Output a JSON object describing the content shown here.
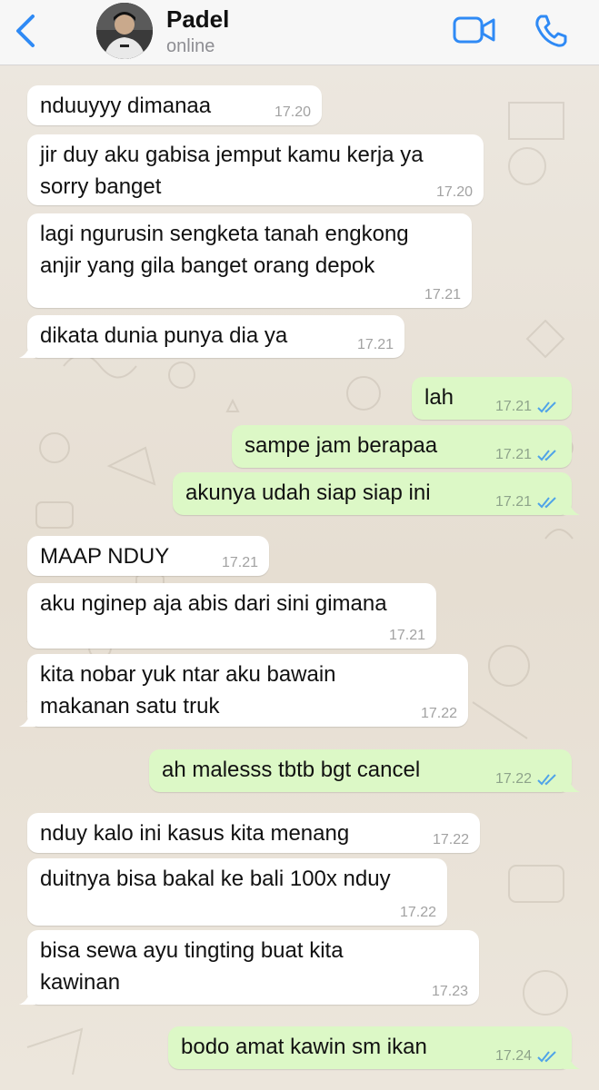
{
  "header": {
    "contact_name": "Padel",
    "status": "online",
    "icons": [
      "back-chevron-icon",
      "video-call-icon",
      "phone-call-icon"
    ]
  },
  "colors": {
    "incoming_bubble": "#ffffff",
    "outgoing_bubble": "#dcf8c6",
    "accent": "#2f8af5",
    "read_ticks": "#4fa3e8"
  },
  "messages": [
    {
      "dir": "in",
      "lines": [
        "nduuyyy dimanaa"
      ],
      "time": "17.20"
    },
    {
      "dir": "in",
      "lines": [
        "jir duy aku gabisa jemput kamu kerja ya",
        "sorry banget"
      ],
      "time": "17.20"
    },
    {
      "dir": "in",
      "lines": [
        "lagi ngurusin sengketa tanah engkong",
        "anjir yang gila banget orang depok"
      ],
      "time": "17.21"
    },
    {
      "dir": "in",
      "lines": [
        "dikata dunia punya dia ya"
      ],
      "time": "17.21"
    },
    {
      "dir": "out",
      "lines": [
        "lah"
      ],
      "time": "17.21"
    },
    {
      "dir": "out",
      "lines": [
        "sampe jam berapaa"
      ],
      "time": "17.21"
    },
    {
      "dir": "out",
      "lines": [
        "akunya udah siap siap ini"
      ],
      "time": "17.21"
    },
    {
      "dir": "in",
      "lines": [
        "MAAP NDUY"
      ],
      "time": "17.21"
    },
    {
      "dir": "in",
      "lines": [
        "aku nginep aja abis dari sini gimana"
      ],
      "time": "17.21"
    },
    {
      "dir": "in",
      "lines": [
        "kita nobar yuk ntar aku bawain",
        "makanan satu truk"
      ],
      "time": "17.22"
    },
    {
      "dir": "out",
      "lines": [
        "ah malesss tbtb bgt cancel"
      ],
      "time": "17.22"
    },
    {
      "dir": "in",
      "lines": [
        "nduy kalo ini kasus kita menang"
      ],
      "time": "17.22"
    },
    {
      "dir": "in",
      "lines": [
        "duitnya bisa bakal ke bali 100x nduy"
      ],
      "time": "17.22"
    },
    {
      "dir": "in",
      "lines": [
        "bisa sewa ayu tingting buat kita",
        "kawinan"
      ],
      "time": "17.23"
    },
    {
      "dir": "out",
      "lines": [
        "bodo amat kawin sm ikan"
      ],
      "time": "17.24"
    }
  ]
}
